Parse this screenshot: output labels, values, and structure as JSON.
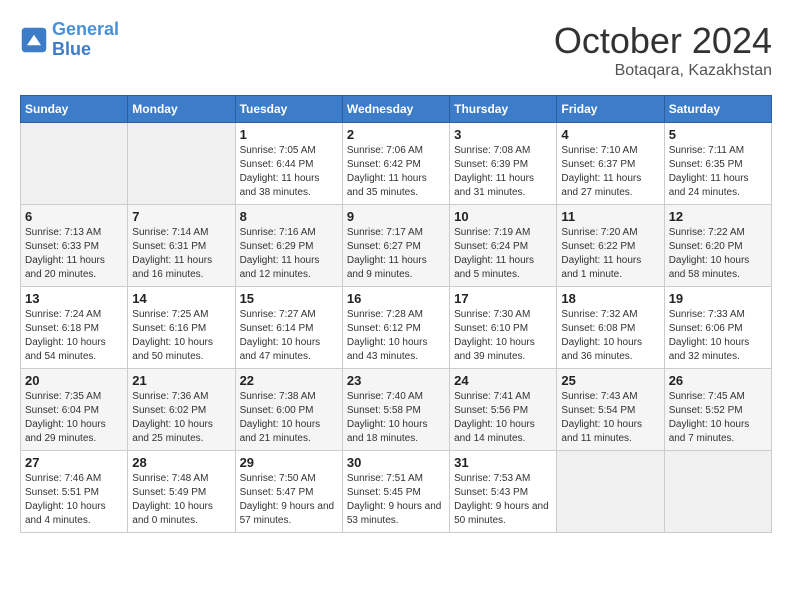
{
  "header": {
    "logo_line1": "General",
    "logo_line2": "Blue",
    "month": "October 2024",
    "location": "Botaqara, Kazakhstan"
  },
  "weekdays": [
    "Sunday",
    "Monday",
    "Tuesday",
    "Wednesday",
    "Thursday",
    "Friday",
    "Saturday"
  ],
  "weeks": [
    [
      {
        "num": "",
        "empty": true
      },
      {
        "num": "",
        "empty": true
      },
      {
        "num": "1",
        "sunrise": "7:05 AM",
        "sunset": "6:44 PM",
        "daylight": "11 hours and 38 minutes."
      },
      {
        "num": "2",
        "sunrise": "7:06 AM",
        "sunset": "6:42 PM",
        "daylight": "11 hours and 35 minutes."
      },
      {
        "num": "3",
        "sunrise": "7:08 AM",
        "sunset": "6:39 PM",
        "daylight": "11 hours and 31 minutes."
      },
      {
        "num": "4",
        "sunrise": "7:10 AM",
        "sunset": "6:37 PM",
        "daylight": "11 hours and 27 minutes."
      },
      {
        "num": "5",
        "sunrise": "7:11 AM",
        "sunset": "6:35 PM",
        "daylight": "11 hours and 24 minutes."
      }
    ],
    [
      {
        "num": "6",
        "sunrise": "7:13 AM",
        "sunset": "6:33 PM",
        "daylight": "11 hours and 20 minutes."
      },
      {
        "num": "7",
        "sunrise": "7:14 AM",
        "sunset": "6:31 PM",
        "daylight": "11 hours and 16 minutes."
      },
      {
        "num": "8",
        "sunrise": "7:16 AM",
        "sunset": "6:29 PM",
        "daylight": "11 hours and 12 minutes."
      },
      {
        "num": "9",
        "sunrise": "7:17 AM",
        "sunset": "6:27 PM",
        "daylight": "11 hours and 9 minutes."
      },
      {
        "num": "10",
        "sunrise": "7:19 AM",
        "sunset": "6:24 PM",
        "daylight": "11 hours and 5 minutes."
      },
      {
        "num": "11",
        "sunrise": "7:20 AM",
        "sunset": "6:22 PM",
        "daylight": "11 hours and 1 minute."
      },
      {
        "num": "12",
        "sunrise": "7:22 AM",
        "sunset": "6:20 PM",
        "daylight": "10 hours and 58 minutes."
      }
    ],
    [
      {
        "num": "13",
        "sunrise": "7:24 AM",
        "sunset": "6:18 PM",
        "daylight": "10 hours and 54 minutes."
      },
      {
        "num": "14",
        "sunrise": "7:25 AM",
        "sunset": "6:16 PM",
        "daylight": "10 hours and 50 minutes."
      },
      {
        "num": "15",
        "sunrise": "7:27 AM",
        "sunset": "6:14 PM",
        "daylight": "10 hours and 47 minutes."
      },
      {
        "num": "16",
        "sunrise": "7:28 AM",
        "sunset": "6:12 PM",
        "daylight": "10 hours and 43 minutes."
      },
      {
        "num": "17",
        "sunrise": "7:30 AM",
        "sunset": "6:10 PM",
        "daylight": "10 hours and 39 minutes."
      },
      {
        "num": "18",
        "sunrise": "7:32 AM",
        "sunset": "6:08 PM",
        "daylight": "10 hours and 36 minutes."
      },
      {
        "num": "19",
        "sunrise": "7:33 AM",
        "sunset": "6:06 PM",
        "daylight": "10 hours and 32 minutes."
      }
    ],
    [
      {
        "num": "20",
        "sunrise": "7:35 AM",
        "sunset": "6:04 PM",
        "daylight": "10 hours and 29 minutes."
      },
      {
        "num": "21",
        "sunrise": "7:36 AM",
        "sunset": "6:02 PM",
        "daylight": "10 hours and 25 minutes."
      },
      {
        "num": "22",
        "sunrise": "7:38 AM",
        "sunset": "6:00 PM",
        "daylight": "10 hours and 21 minutes."
      },
      {
        "num": "23",
        "sunrise": "7:40 AM",
        "sunset": "5:58 PM",
        "daylight": "10 hours and 18 minutes."
      },
      {
        "num": "24",
        "sunrise": "7:41 AM",
        "sunset": "5:56 PM",
        "daylight": "10 hours and 14 minutes."
      },
      {
        "num": "25",
        "sunrise": "7:43 AM",
        "sunset": "5:54 PM",
        "daylight": "10 hours and 11 minutes."
      },
      {
        "num": "26",
        "sunrise": "7:45 AM",
        "sunset": "5:52 PM",
        "daylight": "10 hours and 7 minutes."
      }
    ],
    [
      {
        "num": "27",
        "sunrise": "7:46 AM",
        "sunset": "5:51 PM",
        "daylight": "10 hours and 4 minutes."
      },
      {
        "num": "28",
        "sunrise": "7:48 AM",
        "sunset": "5:49 PM",
        "daylight": "10 hours and 0 minutes."
      },
      {
        "num": "29",
        "sunrise": "7:50 AM",
        "sunset": "5:47 PM",
        "daylight": "9 hours and 57 minutes."
      },
      {
        "num": "30",
        "sunrise": "7:51 AM",
        "sunset": "5:45 PM",
        "daylight": "9 hours and 53 minutes."
      },
      {
        "num": "31",
        "sunrise": "7:53 AM",
        "sunset": "5:43 PM",
        "daylight": "9 hours and 50 minutes."
      },
      {
        "num": "",
        "empty": true
      },
      {
        "num": "",
        "empty": true
      }
    ]
  ]
}
